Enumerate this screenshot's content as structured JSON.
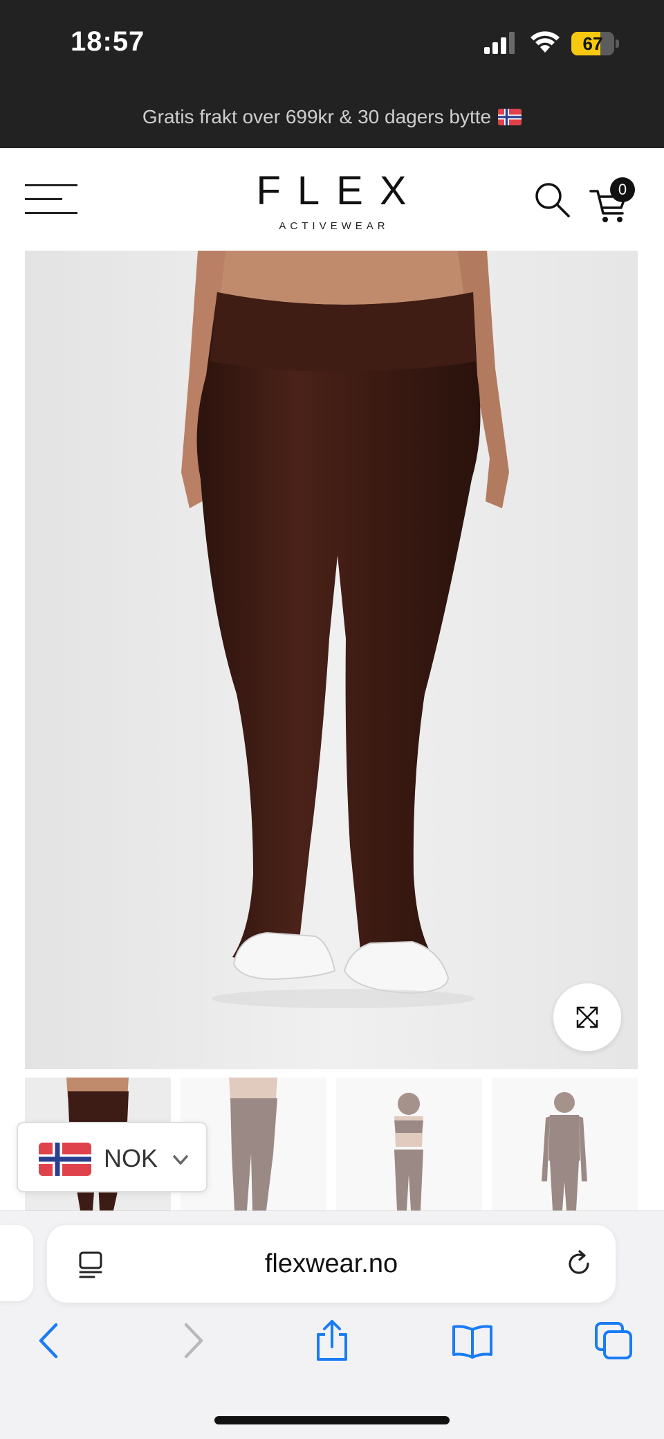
{
  "status_bar": {
    "time": "18:57",
    "battery_level": "67",
    "battery_fraction": 0.67,
    "icons": [
      "cellular-signal-icon",
      "wifi-icon",
      "battery-icon"
    ]
  },
  "promo": {
    "text": "Gratis frakt over 699kr & 30 dagers bytte",
    "flag": "norway-flag-icon"
  },
  "header": {
    "menu_icon": "hamburger-menu-icon",
    "logo_main": "FLEX",
    "logo_sub": "ACTIVEWEAR",
    "search_icon": "search-icon",
    "cart_icon": "cart-icon",
    "cart_count": "0"
  },
  "product": {
    "main_image": "brown flared leggings front view",
    "zoom_icon": "expand-icon",
    "thumbnails": [
      "brown leggings front",
      "brown leggings side",
      "brown set with bra",
      "brown set with long sleeve top"
    ]
  },
  "currency": {
    "code": "NOK",
    "flag": "norway-flag-icon",
    "chevron": "chevron-down-icon"
  },
  "browser": {
    "url": "flexwear.no",
    "reader_icon": "reader-mode-icon",
    "reload_icon": "reload-icon",
    "nav": [
      "back-icon",
      "forward-icon",
      "share-icon",
      "bookmarks-icon",
      "tabs-icon"
    ]
  },
  "colors": {
    "dark_bar": "#222222",
    "accent_blue": "#1a7cf5",
    "product_brown": "#3c1c14",
    "badge_yellow": "#f6c90e"
  }
}
